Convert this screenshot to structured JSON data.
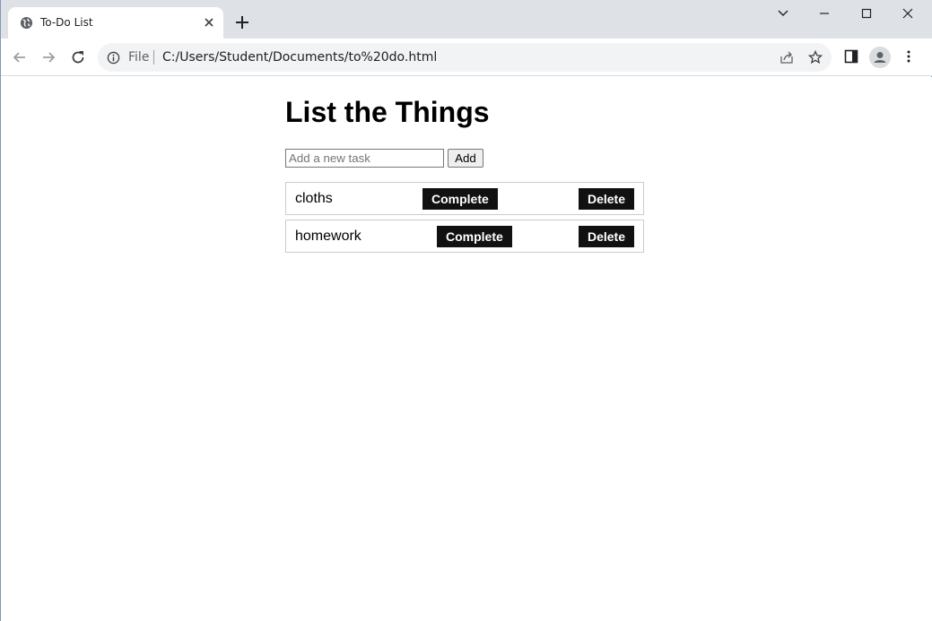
{
  "browser": {
    "tab": {
      "title": "To-Do List"
    },
    "address_bar": {
      "scheme_label": "File",
      "url": "C:/Users/Student/Documents/to%20do.html"
    },
    "icons": {
      "tab_favicon": "globe-icon",
      "tab_close": "close-icon",
      "new_tab": "plus-icon",
      "tab_search": "chevron-down-icon",
      "minimize": "minimize-icon",
      "maximize": "maximize-icon",
      "close_window": "close-icon",
      "back": "arrow-left-icon",
      "forward": "arrow-right-icon",
      "reload": "reload-icon",
      "site_info": "info-icon",
      "share": "share-icon",
      "bookmark": "star-icon",
      "side_panel": "side-panel-icon",
      "profile": "avatar-icon",
      "menu": "kebab-menu-icon"
    },
    "colors": {
      "tabstrip": "#dee1e6",
      "omnibox": "#f1f3f4"
    }
  },
  "page": {
    "heading": "List the Things",
    "input": {
      "placeholder": "Add a new task",
      "value": ""
    },
    "add_label": "Add",
    "tasks": [
      {
        "text": "cloths",
        "complete_label": "Complete",
        "delete_label": "Delete"
      },
      {
        "text": "homework",
        "complete_label": "Complete",
        "delete_label": "Delete"
      }
    ],
    "colors": {
      "button_bg": "#111111",
      "button_text": "#ffffff",
      "border": "#cccccc"
    }
  }
}
